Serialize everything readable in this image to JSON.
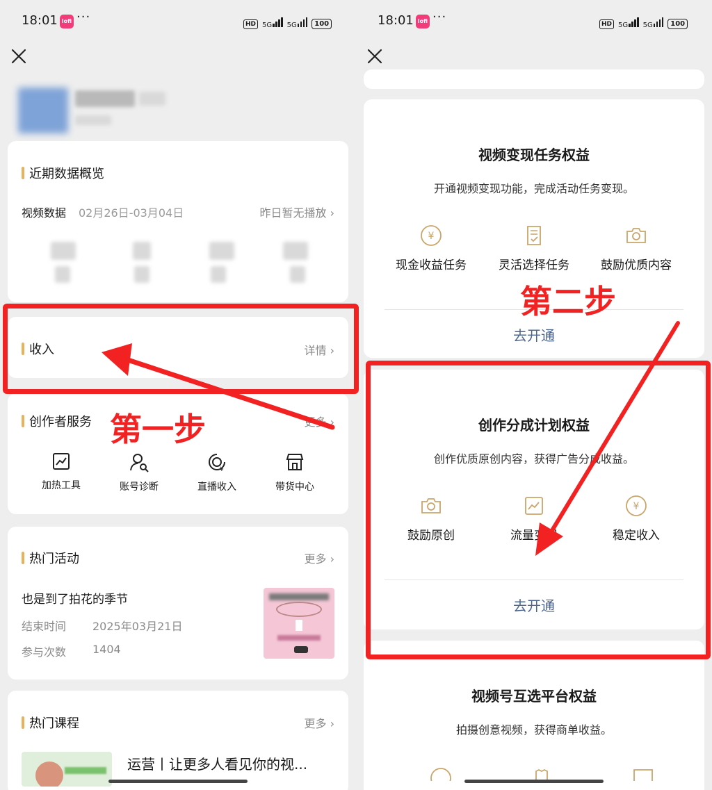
{
  "status_bar": {
    "time": "18:01",
    "app_badge": "lofi",
    "more": "···",
    "hd": "HD",
    "net1": "5G",
    "net2": "5G",
    "battery": "100"
  },
  "left": {
    "overview": {
      "title": "近期数据概览",
      "video_data_label": "视频数据",
      "date_range": "02月26日-03月04日",
      "no_play": "昨日暂无播放 ›"
    },
    "income": {
      "title": "收入",
      "detail": "详情 ›"
    },
    "creator_services": {
      "title": "创作者服务",
      "more": "更多 ›",
      "items": [
        {
          "label": "加热工具",
          "icon": "trend-chart-icon"
        },
        {
          "label": "账号诊断",
          "icon": "user-search-icon"
        },
        {
          "label": "直播收入",
          "icon": "live-income-icon"
        },
        {
          "label": "带货中心",
          "icon": "store-icon"
        }
      ]
    },
    "hot_activity": {
      "title": "热门活动",
      "more": "更多 ›",
      "name": "也是到了拍花的季节",
      "end_label": "结束时间",
      "end_value": "2025年03月21日",
      "count_label": "参与次数",
      "count_value": "1404"
    },
    "hot_course": {
      "title": "热门课程",
      "more": "更多 ›",
      "course_title": "运营丨让更多人看见你的视..."
    }
  },
  "right": {
    "video_monetize": {
      "title": "视频变现任务权益",
      "desc": "开通视频变现功能，完成活动任务变现。",
      "items": [
        {
          "label": "现金收益任务",
          "icon": "yen-circle-icon"
        },
        {
          "label": "灵活选择任务",
          "icon": "document-check-icon"
        },
        {
          "label": "鼓励优质内容",
          "icon": "camera-icon"
        }
      ],
      "button": "去开通"
    },
    "revenue_share": {
      "title": "创作分成计划权益",
      "desc": "创作优质原创内容，获得广告分成收益。",
      "items": [
        {
          "label": "鼓励原创",
          "icon": "camera-icon"
        },
        {
          "label": "流量变现",
          "icon": "trend-chart-icon"
        },
        {
          "label": "稳定收入",
          "icon": "yen-circle-icon"
        }
      ],
      "button": "去开通"
    },
    "mutual_select": {
      "title": "视频号互选平台权益",
      "desc": "拍摄创意视频，获得商单收益。"
    }
  },
  "annotations": {
    "step1": "第一步",
    "step2": "第二步",
    "color": "#f22222"
  },
  "colors": {
    "accent_bar": "#e8b25c",
    "link_blue": "#4d6690",
    "background": "#eeeeee"
  }
}
